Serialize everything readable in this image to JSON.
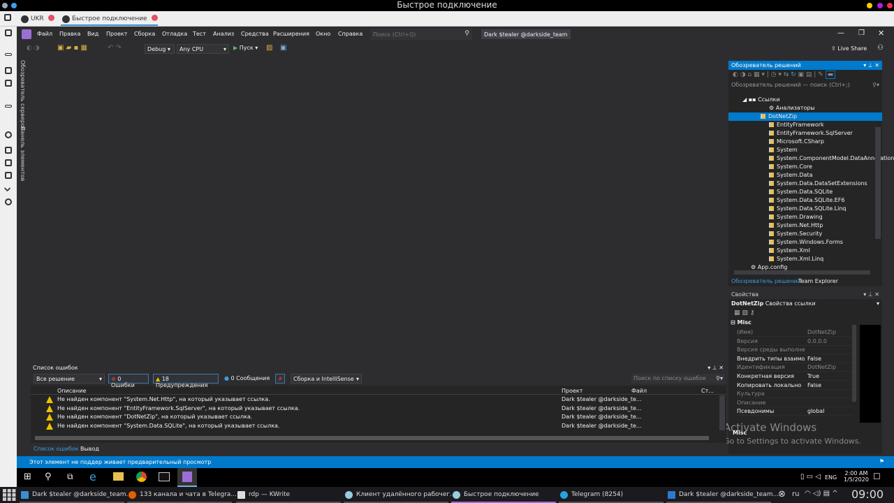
{
  "window_title": "Быстрое подключение",
  "remote_tabs": [
    {
      "label": "UKR"
    },
    {
      "label": "Быстрое подключение"
    }
  ],
  "vs": {
    "menu": [
      "Файл",
      "Правка",
      "Вид",
      "Проект",
      "Сборка",
      "Отладка",
      "Тест",
      "Анализ",
      "Средства",
      "Расширения",
      "Окно",
      "Справка"
    ],
    "search_placeholder": "Поиск (Ctrl+Q)",
    "user_title": "Dark $tealer @darkside_team",
    "live_share": "Live Share",
    "toolbar": {
      "config": "Debug",
      "platform": "Any CPU",
      "run": "Пуск"
    },
    "vertical_tabs": [
      "Обозреватель серверов",
      "Панель элементов"
    ]
  },
  "solution_explorer": {
    "title": "Обозреватель решений",
    "search_placeholder": "Обозреватель решений — поиск (Ctrl+;)",
    "references_label": "Ссылки",
    "analyzers": "Анализаторы",
    "items": [
      "DotNetZip",
      "EntityFramework",
      "EntityFramework.SqlServer",
      "Microsoft.CSharp",
      "System",
      "System.ComponentModel.DataAnnotations",
      "System.Core",
      "System.Data",
      "System.Data.DataSetExtensions",
      "System.Data.SQLite",
      "System.Data.SQLite.EF6",
      "System.Data.SQLite.Linq",
      "System.Drawing",
      "System.Net.Http",
      "System.Security",
      "System.Windows.Forms",
      "System.Xml",
      "System.Xml.Linq"
    ],
    "selected": "DotNetZip",
    "app_config": "App.config",
    "tabs": [
      "Обозреватель решений",
      "Team Explorer"
    ]
  },
  "properties": {
    "title": "Свойства",
    "object": "DotNetZip",
    "object_type": "Свойства ссылки",
    "category": "Misc",
    "rows": [
      {
        "k": "(Имя)",
        "v": "DotNetZip",
        "dim": true
      },
      {
        "k": "Версия",
        "v": "0.0.0.0",
        "dim": true
      },
      {
        "k": "Версия среды выполнения",
        "v": "",
        "dim": true
      },
      {
        "k": "Внедрить типы взаимодействия",
        "v": "False",
        "dim": false
      },
      {
        "k": "Идентификация",
        "v": "DotNetZip",
        "dim": true
      },
      {
        "k": "Конкретная версия",
        "v": "True",
        "dim": false
      },
      {
        "k": "Копировать локально",
        "v": "False",
        "dim": false
      },
      {
        "k": "Культура",
        "v": "",
        "dim": true
      },
      {
        "k": "Описание",
        "v": "",
        "dim": true
      },
      {
        "k": "Псевдонимы",
        "v": "global",
        "dim": false
      }
    ],
    "footer": "Misc"
  },
  "error_list": {
    "title": "Список ошибок",
    "scope": "Все решение",
    "errors": "0 Ошибки",
    "warnings": "18 Предупреждения",
    "messages": "0 Сообщения",
    "source": "Сборка и IntelliSense",
    "search_placeholder": "Поиск по списку ошибок",
    "columns": [
      "Описание",
      "Проект",
      "Файл",
      "Ст..."
    ],
    "rows": [
      {
        "desc": "Не найден компонент \"System.Net.Http\", на который указывает ссылка.",
        "project": "Dark $tealer @darkside_te..."
      },
      {
        "desc": "Не найден компонент \"EntityFramework.SqlServer\", на который указывает ссылка.",
        "project": "Dark $tealer @darkside_te..."
      },
      {
        "desc": "Не найден компонент \"DotNetZip\", на который указывает ссылка.",
        "project": "Dark $tealer @darkside_te..."
      },
      {
        "desc": "Не найден компонент \"System.Data.SQLite\", на который указывает ссылка.",
        "project": "Dark $tealer @darkside_te..."
      }
    ],
    "tabs": [
      "Список ошибок",
      "Вывод"
    ]
  },
  "status_text": "Этот элемент не поддер живает предварительный просмотр",
  "activate": {
    "title": "Activate Windows",
    "subtitle": "Go to Settings to activate Windows."
  },
  "win_taskbar": {
    "lang": "ENG",
    "time": "2:00 AM",
    "date": "1/5/2020"
  },
  "linux_taskbar": {
    "items": [
      "Dark $tealer @darkside_team...",
      "133 канала и чата в Telegra...",
      "rdp — KWrite",
      "Клиент удалённого рабочег...",
      "Быстрое подключение",
      "Telegram (8254)",
      "Dark $tealer @darkside_team..."
    ],
    "lang": "ru",
    "clock": "09:00"
  },
  "colors": {
    "accent": "#007acc",
    "vs_bg": "#2d2d30",
    "panel_bg": "#252526",
    "warning": "#f0c000"
  }
}
